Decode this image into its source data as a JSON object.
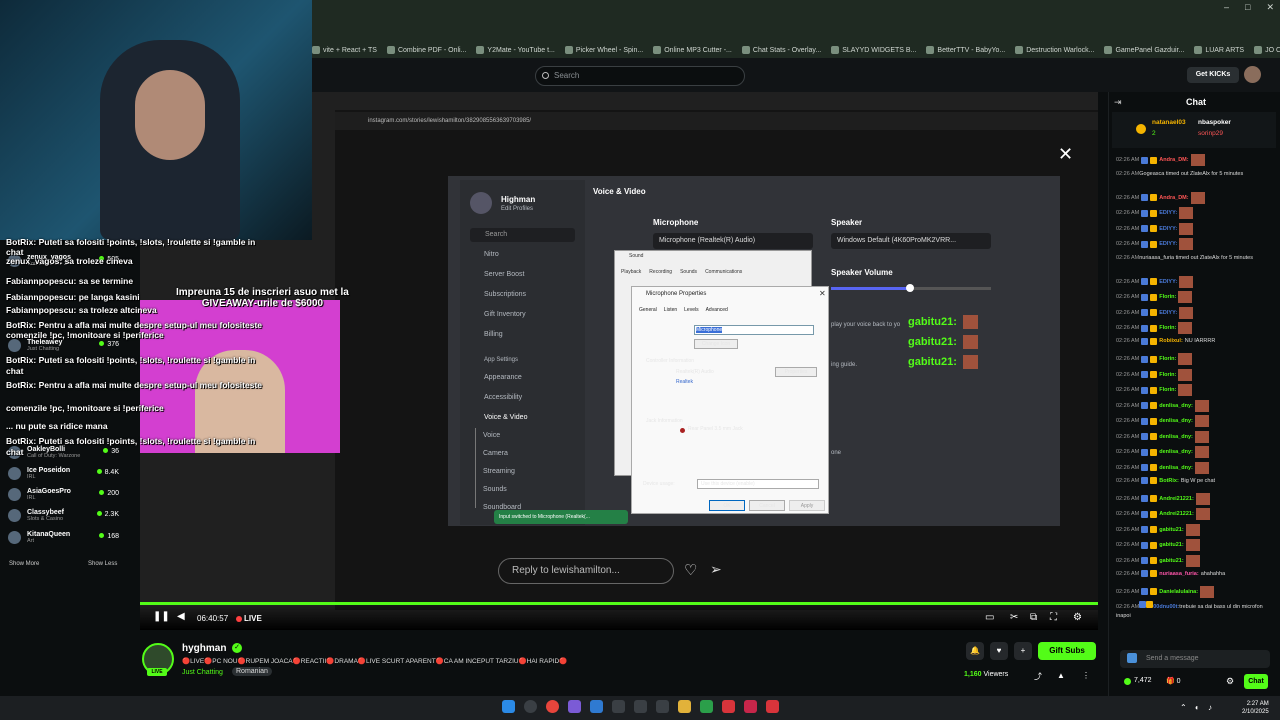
{
  "browser": {
    "bookmarks": [
      "vite + React + TS",
      "Combine PDF - Onli...",
      "Y2Mate - YouTube t...",
      "Picker Wheel - Spin...",
      "Online MP3 Cutter -...",
      "Chat Stats - Overlay...",
      "SLAYYD WIDGETS B...",
      "BetterTTV - BabyYo...",
      "Destruction Warlock...",
      "GamePanel Gazduir...",
      "LUAR ARTS",
      "JO CHORROR",
      "Audioalter"
    ]
  },
  "header": {
    "search_placeholder": "Search",
    "get_kicks": "Get KICKs"
  },
  "video": {
    "url": "instagram.com/stories/lewishamilton/3829085563639703985/",
    "reply_placeholder": "Reply to lewishamilton...",
    "time": "06:40:57",
    "live": "LIVE"
  },
  "discord": {
    "username": "Highman",
    "edit_profiles": "Edit Profiles",
    "search": "Search",
    "nav": [
      "Nitro",
      "Server Boost",
      "Subscriptions",
      "Gift Inventory",
      "Billing",
      "App Settings",
      "Appearance",
      "Accessibility",
      "Voice & Video",
      "Voice",
      "Camera",
      "Streaming",
      "Sounds",
      "Soundboard"
    ],
    "title": "Voice & Video",
    "microphone": "Microphone",
    "microphone_value": "Microphone (Realtek(R) Audio)",
    "speaker": "Speaker",
    "speaker_value": "Windows Default (4K60ProMK2VRR...",
    "speaker_volume": "Speaker Volume",
    "volume_level": 0.5,
    "play_back_text": "play your voice back to yo",
    "guide_text": "ing guide.",
    "none_text": "one",
    "toast": "Input switched to Microphone (Realtek(..."
  },
  "sound_dialog": {
    "title": "Sound",
    "tabs": [
      "Playback",
      "Recording",
      "Sounds",
      "Communications"
    ]
  },
  "mic_props": {
    "title": "Microphone Properties",
    "tabs": [
      "General",
      "Listen",
      "Levels",
      "Advanced"
    ],
    "name": "Microphone",
    "change_icon": "Change Icon",
    "controller_info": "Controller Information",
    "controller": "Realtek(R) Audio",
    "vendor": "Realtek",
    "properties": "Properties",
    "jack_info": "Jack Information",
    "jack": "Rear Panel 3.5 mm Jack",
    "device_usage": "Device usage:",
    "usage_value": "Use this device (enable)",
    "ok": "OK",
    "cancel": "Cancel",
    "apply": "Apply"
  },
  "gabitu": [
    "gabitu21:",
    "gabitu21:",
    "gabitu21:"
  ],
  "overlay_chat": [
    "BotRix: Puteti sa folositi !points, !slots, !roulette si !gamble in",
    "chat",
    "zenux_vagos: sa troleze cineva",
    "Fabiannpopescu: sa se termine",
    "Fabiannpopescu: pe langa kasini",
    "Fabiannpopescu: sa troleze altcineva",
    "BotRix: Pentru a afla mai multe despre setup-ul meu folositeste",
    "comenzile !pc, !monitoare si !periferice",
    "BotRix: Puteti sa folositi !points, !slots, !roulette si !gamble in",
    "chat",
    "BotRix: Pentru a afla mai multe despre setup-ul meu folositeste",
    "comenzile !pc, !monitoare si !periferice",
    "... nu pute sa ridice mana",
    "BotRix: Puteti sa folositi !points, !slots, !roulette si !gamble in",
    "chat"
  ],
  "giveaway": [
    "Impreuna 15 de inscrieri asuo met la",
    "GIVEAWAY-urile de $6000"
  ],
  "channels": [
    {
      "name": "zenux_vagos",
      "game": "Counter-Strike 2",
      "viewers": "505"
    },
    {
      "name": "Theleawey",
      "game": "Just Chatting",
      "viewers": "376"
    },
    {
      "name": "OakleyBolli",
      "game": "Call of Duty: Warzone",
      "viewers": "36"
    },
    {
      "name": "Ice Poseidon",
      "game": "IRL",
      "viewers": "8.4K"
    },
    {
      "name": "AsiaGoesPro",
      "game": "IRL",
      "viewers": "200"
    },
    {
      "name": "Classybeef",
      "game": "Slots & Casino",
      "viewers": "2.3K"
    },
    {
      "name": "KitanaQueen",
      "game": "Art",
      "viewers": "168"
    }
  ],
  "channel_nav": {
    "show_more": "Show More",
    "show_less": "Show Less"
  },
  "stream": {
    "name": "hyghman",
    "live_badge": "LIVE",
    "title": "🔴LIVE🔴PC NOU🔴RUPEM JOACA🔴REACTII🔴DRAMA🔴LIVE SCURT APARENT🔴CA AM INCEPUT TARZIU🔴HAI RAPID🔴",
    "category": "Just Chatting",
    "tag": "Romanian",
    "gift_subs": "Gift Subs",
    "viewers": "1,160",
    "viewers_label": "Viewers"
  },
  "chat": {
    "title": "Chat",
    "pinned": [
      {
        "user": "natanael03",
        "count": "2"
      },
      {
        "user": "nbaspoker",
        "count": "1"
      }
    ],
    "pinned_extra": "sorinp29",
    "messages": [
      {
        "time": "02:26 AM",
        "user": "Andra_DM:",
        "color": "#f55",
        "text": "",
        "emote": true
      },
      {
        "time": "02:26 AM",
        "user": "",
        "color": "#ddd",
        "text": "Gogeasca timed out ZlateAlx for 5 minutes",
        "system": true
      },
      {
        "time": "02:26 AM",
        "user": "Andra_DM:",
        "color": "#f55",
        "text": "",
        "emote": true
      },
      {
        "time": "02:26 AM",
        "user": "EDIYY:",
        "color": "#4a7ad8",
        "text": "",
        "emote": true
      },
      {
        "time": "02:26 AM",
        "user": "EDIYY:",
        "color": "#4a7ad8",
        "text": "",
        "emote": true
      },
      {
        "time": "02:26 AM",
        "user": "EDIYY:",
        "color": "#4a7ad8",
        "text": "",
        "emote": true
      },
      {
        "time": "02:26 AM",
        "user": "",
        "color": "#ddd",
        "text": "nuriaasa_furia timed out ZlateAlx for 5 minutes",
        "system": true
      },
      {
        "time": "02:26 AM",
        "user": "EDIYY:",
        "color": "#4a7ad8",
        "text": "",
        "emote": true
      },
      {
        "time": "02:26 AM",
        "user": "Florin:",
        "color": "#53fc18",
        "text": "",
        "emote": true
      },
      {
        "time": "02:26 AM",
        "user": "EDIYY:",
        "color": "#4a7ad8",
        "text": "",
        "emote": true
      },
      {
        "time": "02:26 AM",
        "user": "Florin:",
        "color": "#53fc18",
        "text": "",
        "emote": true
      },
      {
        "time": "02:26 AM",
        "user": "Robiixul:",
        "color": "#f5b400",
        "text": "NU IARRRR",
        "emote": false
      },
      {
        "time": "02:26 AM",
        "user": "Florin:",
        "color": "#53fc18",
        "text": "",
        "emote": true
      },
      {
        "time": "02:26 AM",
        "user": "Florin:",
        "color": "#53fc18",
        "text": "",
        "emote": true
      },
      {
        "time": "02:26 AM",
        "user": "Florin:",
        "color": "#53fc18",
        "text": "",
        "emote": true
      },
      {
        "time": "02:26 AM",
        "user": "denlisa_dny:",
        "color": "#53fc18",
        "text": "",
        "emote": true
      },
      {
        "time": "02:26 AM",
        "user": "denlisa_dny:",
        "color": "#53fc18",
        "text": "",
        "emote": true
      },
      {
        "time": "02:26 AM",
        "user": "denlisa_dny:",
        "color": "#53fc18",
        "text": "",
        "emote": true
      },
      {
        "time": "02:26 AM",
        "user": "denlisa_dny:",
        "color": "#53fc18",
        "text": "",
        "emote": true
      },
      {
        "time": "02:26 AM",
        "user": "denlisa_dny:",
        "color": "#53fc18",
        "text": "",
        "emote": true
      },
      {
        "time": "02:26 AM",
        "user": "BotRix:",
        "color": "#53fc18",
        "text": "Big W pe chat",
        "emote": false
      },
      {
        "time": "02:26 AM",
        "user": "Andrei21221:",
        "color": "#53fc18",
        "text": "",
        "emote": true
      },
      {
        "time": "02:26 AM",
        "user": "Andrei21221:",
        "color": "#53fc18",
        "text": "",
        "emote": true
      },
      {
        "time": "02:26 AM",
        "user": "gabitu21:",
        "color": "#53fc18",
        "text": "",
        "emote": true
      },
      {
        "time": "02:26 AM",
        "user": "gabitu21:",
        "color": "#53fc18",
        "text": "",
        "emote": true
      },
      {
        "time": "02:26 AM",
        "user": "gabitu21:",
        "color": "#53fc18",
        "text": "",
        "emote": true
      },
      {
        "time": "02:26 AM",
        "user": "nuriaasa_furia:",
        "color": "#f5a",
        "text": "ahahahha",
        "emote": false
      },
      {
        "time": "02:26 AM",
        "user": "Danielalulaina:",
        "color": "#53fc18",
        "text": "",
        "emote": true
      },
      {
        "time": "02:26 AM",
        "user": "00dnu00t:",
        "color": "#4a7ad8",
        "text": "trebuie sa dai bass ul din microfon inapoi",
        "emote": false,
        "wrap": true
      }
    ],
    "send_placeholder": "Send a message",
    "points": "7,472",
    "gifts": "0",
    "chat_button": "Chat"
  },
  "taskbar": {
    "time": "2:27 AM",
    "date": "2/10/2025"
  }
}
